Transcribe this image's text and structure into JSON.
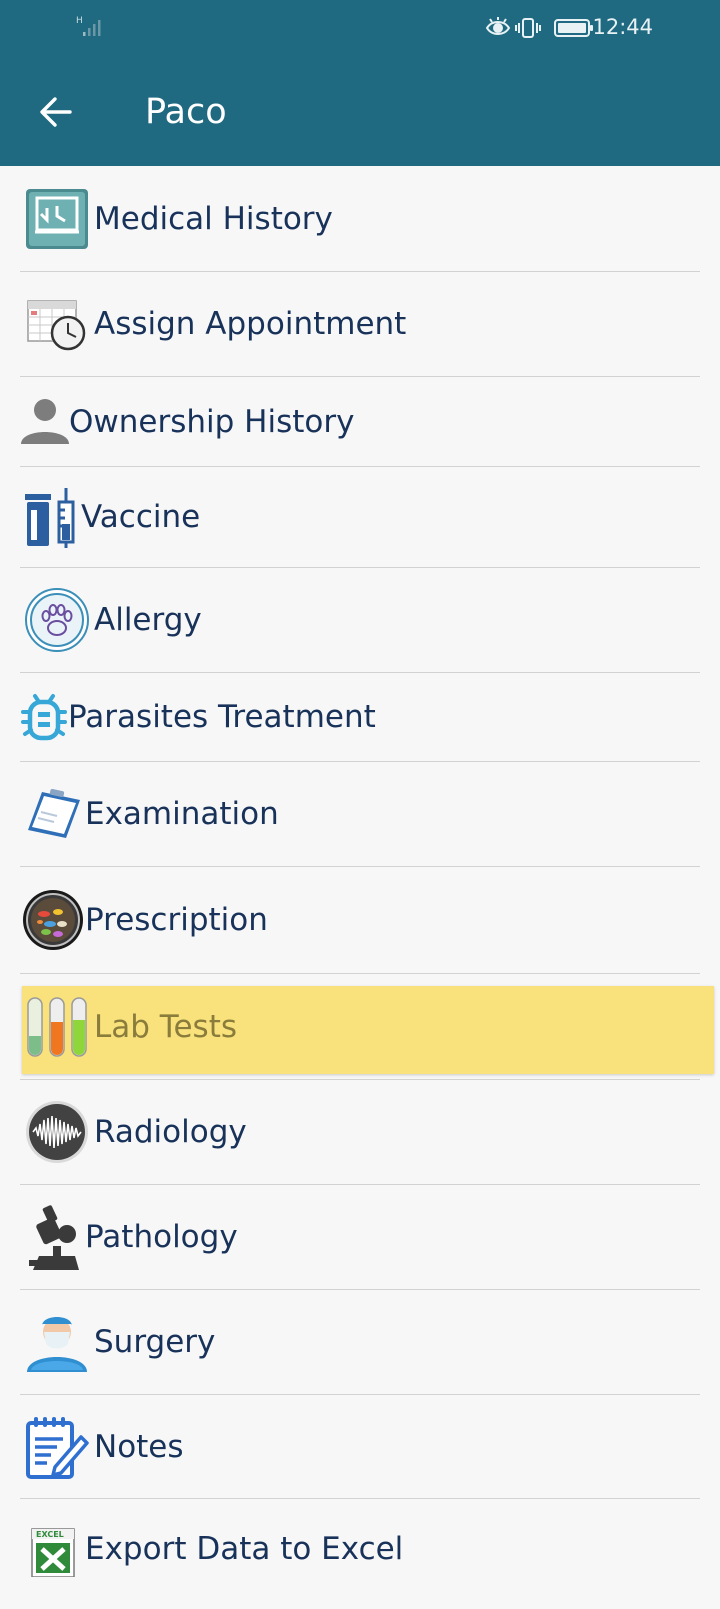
{
  "status_bar": {
    "time": "12:44",
    "network": "H",
    "icons": [
      "eye-icon",
      "vibrate-icon",
      "battery-icon"
    ]
  },
  "header": {
    "title": "Paco",
    "back_icon": "arrow-left-icon",
    "color": "#1f6a80"
  },
  "menu": [
    {
      "label": "Medical History",
      "icon": "history-icon"
    },
    {
      "label": "Assign Appointment",
      "icon": "calendar-clock-icon"
    },
    {
      "label": "Ownership History",
      "icon": "person-icon"
    },
    {
      "label": "Vaccine",
      "icon": "vaccine-syringe-icon"
    },
    {
      "label": "Allergy",
      "icon": "paw-icon"
    },
    {
      "label": "Parasites Treatment",
      "icon": "bug-icon"
    },
    {
      "label": "Examination",
      "icon": "clipboard-icon"
    },
    {
      "label": "Prescription",
      "icon": "pills-icon"
    },
    {
      "label": "Lab Tests",
      "icon": "test-tubes-icon",
      "highlighted": true
    },
    {
      "label": "Radiology",
      "icon": "waveform-icon"
    },
    {
      "label": "Pathology",
      "icon": "microscope-icon"
    },
    {
      "label": "Surgery",
      "icon": "surgeon-icon"
    },
    {
      "label": "Notes",
      "icon": "notepad-icon"
    },
    {
      "label": "Export Data to Excel",
      "icon": "excel-icon"
    }
  ],
  "highlight_color": "#f9e27c"
}
